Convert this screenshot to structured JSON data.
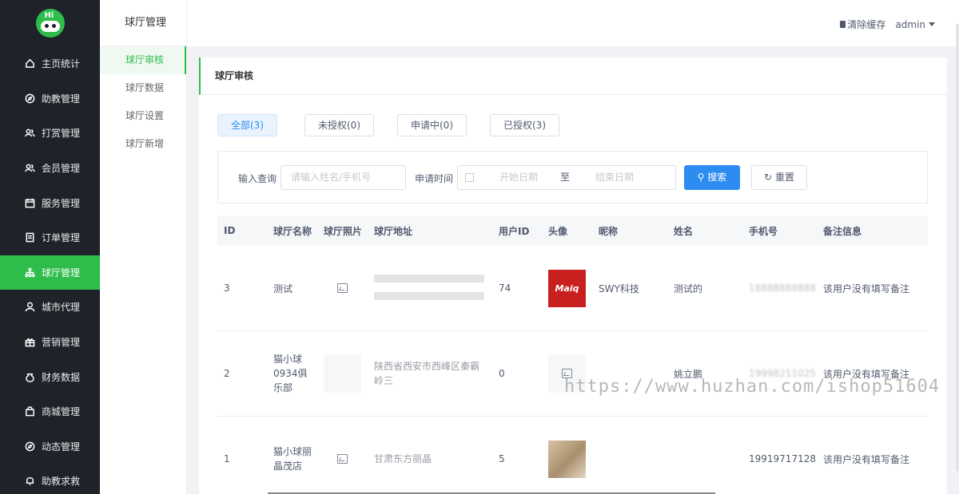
{
  "sidebar": {
    "logo_text": "Hi",
    "items": [
      {
        "label": "主页统计",
        "icon": "home-icon"
      },
      {
        "label": "助教管理",
        "icon": "compass-icon"
      },
      {
        "label": "打赏管理",
        "icon": "users-icon"
      },
      {
        "label": "会员管理",
        "icon": "users-icon"
      },
      {
        "label": "服务管理",
        "icon": "calendar-icon"
      },
      {
        "label": "订单管理",
        "icon": "document-icon"
      },
      {
        "label": "球厅管理",
        "icon": "sitemap-icon",
        "active": true
      },
      {
        "label": "城市代理",
        "icon": "person-icon"
      },
      {
        "label": "营销管理",
        "icon": "gift-icon"
      },
      {
        "label": "财务数据",
        "icon": "moneybag-icon"
      },
      {
        "label": "商城管理",
        "icon": "bag-icon"
      },
      {
        "label": "动态管理",
        "icon": "compass-icon"
      },
      {
        "label": "助教求救",
        "icon": "bell-icon"
      }
    ]
  },
  "subnav": {
    "title": "球厅管理",
    "items": [
      {
        "label": "球厅审核",
        "active": true
      },
      {
        "label": "球厅数据"
      },
      {
        "label": "球厅设置"
      },
      {
        "label": "球厅新增"
      }
    ]
  },
  "topbar": {
    "clear_cache": "清除缓存",
    "user": "admin"
  },
  "card": {
    "title": "球厅审核",
    "tabs": [
      {
        "label": "全部(3)",
        "active": true
      },
      {
        "label": "未授权(0)"
      },
      {
        "label": "申请中(0)"
      },
      {
        "label": "已授权(3)"
      }
    ],
    "filter": {
      "query_label": "输入查询",
      "query_placeholder": "请输入姓名/手机号",
      "time_label": "申请时间",
      "start_placeholder": "开始日期",
      "to": "至",
      "end_placeholder": "结束日期",
      "search": "搜索",
      "reset": "重置"
    },
    "table": {
      "headers": [
        "ID",
        "球厅名称",
        "球厅照片",
        "球厅地址",
        "用户ID",
        "头像",
        "昵称",
        "姓名",
        "手机号",
        "备注信息"
      ],
      "rows": [
        {
          "id": "3",
          "name": "测试",
          "address": "",
          "user_id": "74",
          "avatar_text": "Maiq",
          "nickname": "SWY科技",
          "realname": "测试的",
          "phone": "18888888888",
          "remark": "该用户没有填写备注"
        },
        {
          "id": "2",
          "name": "猫小球0934俱乐部",
          "address": "陕西省西安市西峰区秦霸岭三",
          "user_id": "0",
          "avatar_text": "",
          "nickname": "",
          "realname": "姚立鹏",
          "phone": "19998211025",
          "remark": "该用户没有填写备注"
        },
        {
          "id": "1",
          "name": "猫小球丽晶茂店",
          "address": "甘肃东方丽晶",
          "user_id": "5",
          "avatar_text": "",
          "nickname": "",
          "realname": "",
          "phone": "19919717128",
          "remark": "该用户没有填写备注"
        }
      ]
    }
  },
  "watermark": "https://www.huzhan.com/ishop51604"
}
